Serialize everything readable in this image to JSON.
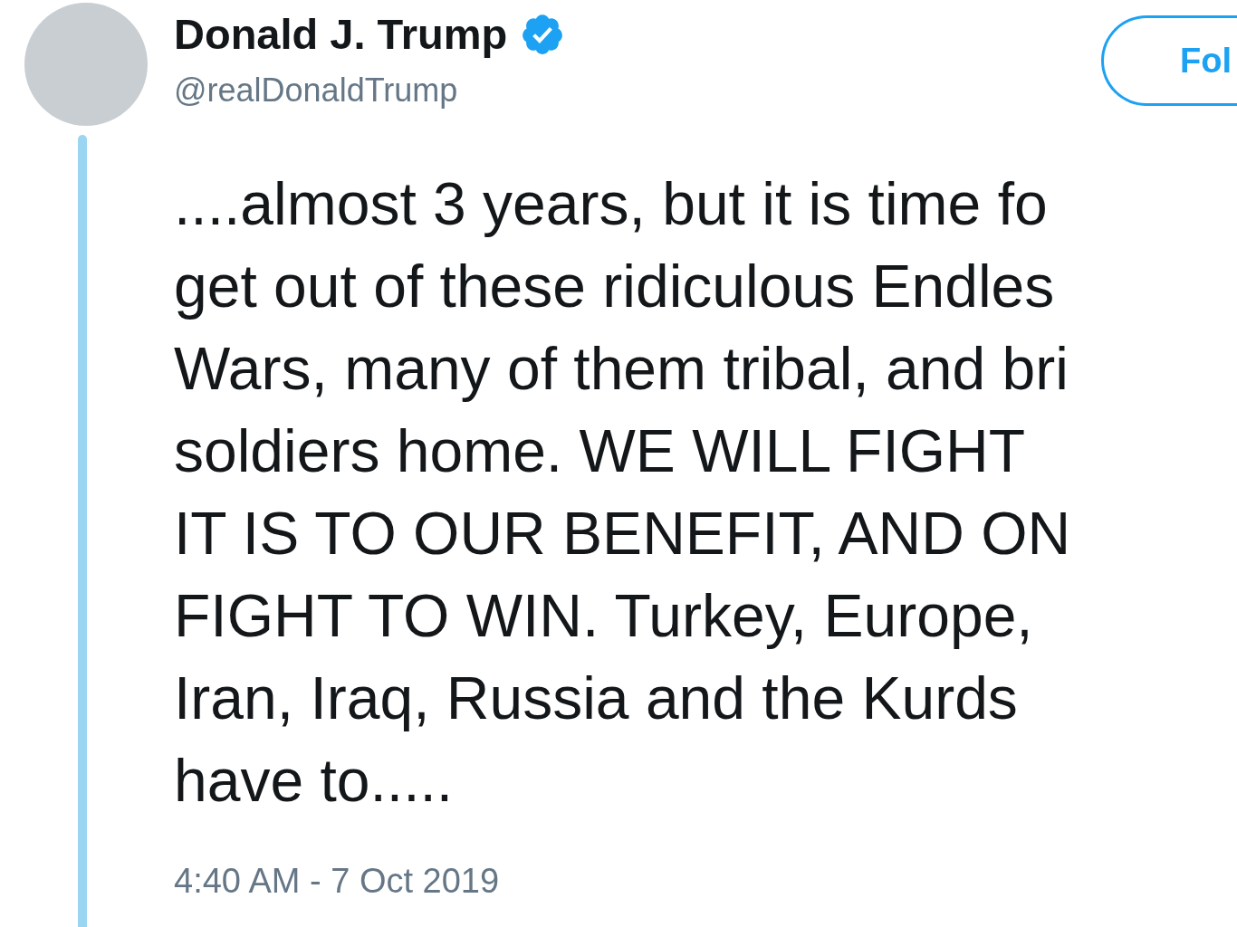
{
  "author": {
    "name": "Donald J. Trump",
    "verified": true,
    "handle": "@realDonaldTrump"
  },
  "follow_button": {
    "label": "Fol"
  },
  "tweet": {
    "lines": [
      "....almost 3 years, but it is time fo",
      "get out of these ridiculous Endles",
      "Wars, many of them tribal, and bri",
      "soldiers home. WE WILL FIGHT",
      "IT IS TO OUR BENEFIT, AND ON",
      "FIGHT TO WIN. Turkey, Europe,",
      "Iran, Iraq, Russia and the Kurds",
      "have to....."
    ],
    "timestamp": "4:40 AM - 7 Oct 2019"
  }
}
